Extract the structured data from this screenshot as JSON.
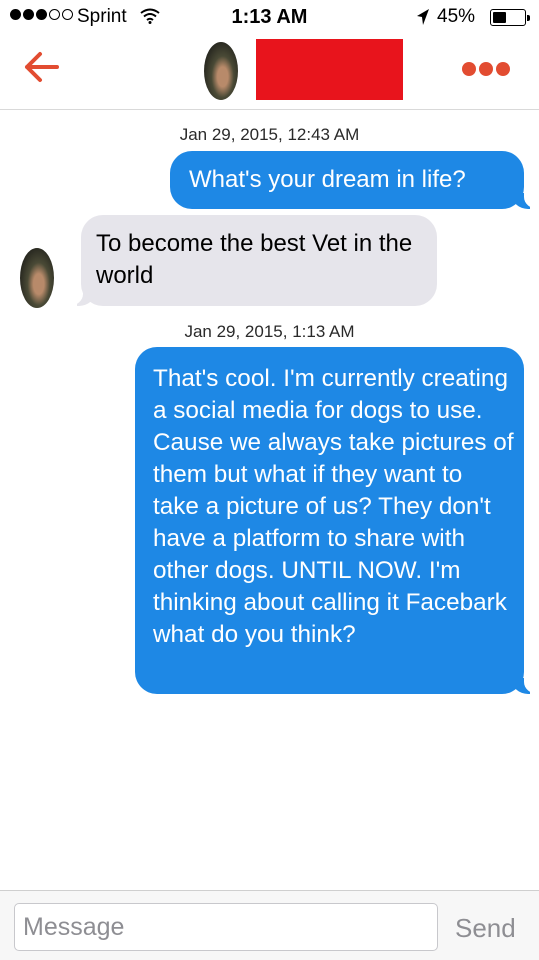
{
  "status_bar": {
    "carrier": "Sprint",
    "time": "1:13 AM",
    "battery_percent": "45%",
    "battery_level": 0.45,
    "signal_bars_filled": 3,
    "signal_bars_total": 5,
    "icons": [
      "wifi-icon",
      "location-arrow-icon",
      "battery-icon"
    ]
  },
  "header": {
    "back_icon": "back-arrow-icon",
    "more_icon": "more-dots-icon",
    "accent_color": "#e24c31"
  },
  "chat": {
    "messages": [
      {
        "timestamp": "Jan 29, 2015, 12:43 AM",
        "sender": "me",
        "text": "What's your dream in life?"
      },
      {
        "sender": "them",
        "text": "To become the best Vet in the world"
      },
      {
        "timestamp": "Jan 29, 2015, 1:13 AM",
        "sender": "me",
        "text": "That's cool. I'm currently creating a social media for dogs to use. Cause we always take pictures of them but what if they want to take a picture of us? They don't have a platform to share with other dogs. UNTIL NOW. I'm thinking about calling it Facebark what do you think?"
      }
    ],
    "sent_bubble_color": "#1e88e5",
    "received_bubble_color": "#e6e5eb"
  },
  "compose": {
    "placeholder": "Message",
    "value": "",
    "send_label": "Send"
  }
}
